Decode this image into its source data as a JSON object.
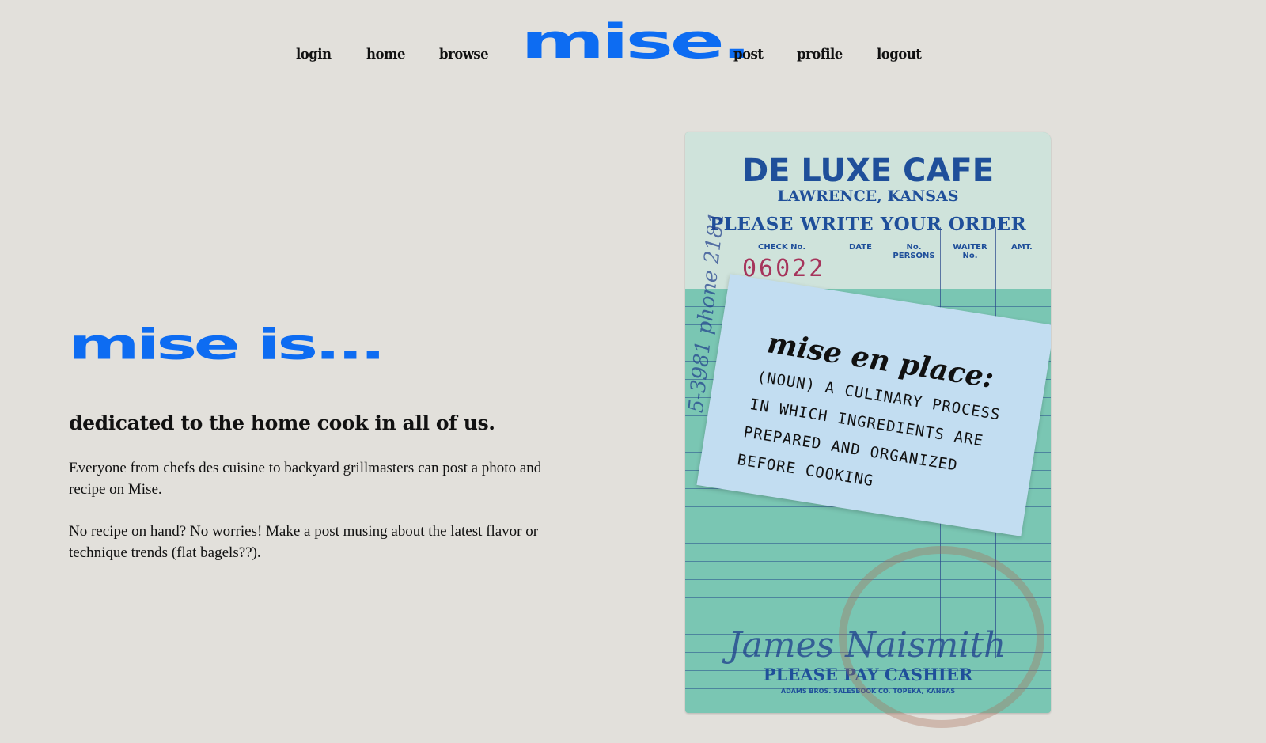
{
  "nav": {
    "left_links": [
      "login",
      "home",
      "browse"
    ],
    "logo": "mise.",
    "right_links": [
      "post",
      "profile",
      "logout"
    ]
  },
  "hero": {
    "headline": "mise is...",
    "subheading": "dedicated to the home cook in all of us.",
    "paragraph_1": "Everyone from chefs des cuisine to backyard grillmasters can post a photo and recipe on Mise.",
    "paragraph_2": "No recipe on hand? No worries! Make a post musing about the latest flavor or technique trends (flat bagels??)."
  },
  "image": {
    "cafe_name": "DE LUXE CAFE",
    "location": "LAWRENCE, KANSAS",
    "order_prompt": "PLEASE WRITE YOUR ORDER",
    "columns": [
      "CHECK No.",
      "DATE",
      "No. PERSONS",
      "WAITER No.",
      "AMT."
    ],
    "check_number": "06022",
    "note_title": "mise en place:",
    "note_lines": [
      "(NOUN) A CULINARY PROCESS",
      "IN WHICH INGREDIENTS ARE",
      "PREPARED AND ORGANIZED",
      "BEFORE COOKING"
    ],
    "signature": "James Naismith",
    "footer": "PLEASE PAY CASHIER",
    "printer": "ADAMS BROS. SALESBOOK CO. TOPEKA, KANSAS",
    "vertical_handwriting": "5-3981 phone 2181",
    "accent_color": "#0d6cf2"
  }
}
